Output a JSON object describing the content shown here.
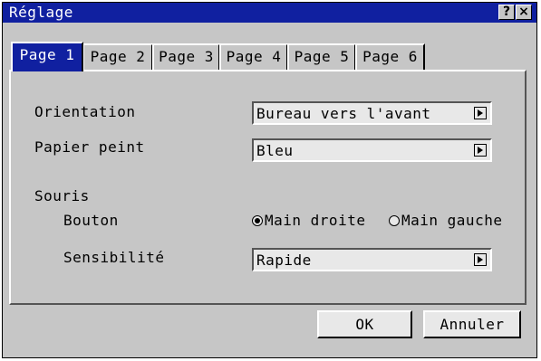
{
  "window": {
    "title": "Réglage",
    "help_label": "?",
    "close_label": "×"
  },
  "tabs": [
    {
      "label": "Page 1",
      "active": true
    },
    {
      "label": "Page 2",
      "active": false
    },
    {
      "label": "Page 3",
      "active": false
    },
    {
      "label": "Page 4",
      "active": false
    },
    {
      "label": "Page 5",
      "active": false
    },
    {
      "label": "Page 6",
      "active": false
    }
  ],
  "settings": {
    "orientation": {
      "label": "Orientation",
      "value": "Bureau vers l'avant"
    },
    "wallpaper": {
      "label": "Papier peint",
      "value": "Bleu"
    },
    "mouse": {
      "label": "Souris",
      "button": {
        "label": "Bouton",
        "options": [
          {
            "label": "Main droite",
            "selected": true
          },
          {
            "label": "Main gauche",
            "selected": false
          }
        ]
      },
      "sensitivity": {
        "label": "Sensibilité",
        "value": "Rapide"
      }
    }
  },
  "buttons": {
    "ok": "OK",
    "cancel": "Annuler"
  }
}
